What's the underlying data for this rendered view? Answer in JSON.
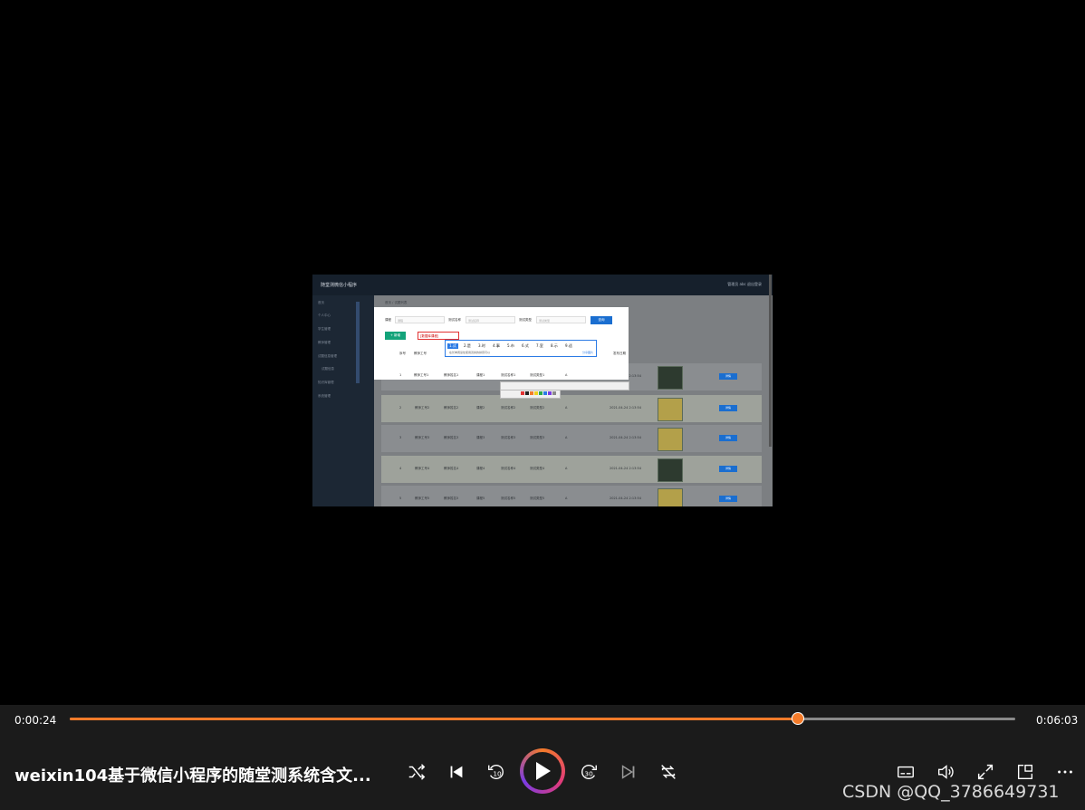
{
  "video": {
    "app_title": "随堂测微信小程序",
    "user_area": "管理员 abc    退出登录",
    "breadcrumb": "首页  /  试题列表",
    "sidebar": [
      "首页",
      "个人中心",
      "学生管理",
      "教师管理",
      "试题信息管理",
      "试题信息",
      "知识库管理",
      "系统管理"
    ],
    "rows": [
      {
        "idx": "1",
        "c1": "教师工号1",
        "c2": "教师姓名1",
        "c3": "课程1",
        "c4": "测试名称1",
        "c5": "测试类型1",
        "c6": "A",
        "c7": "2021-04-24 2:13:54",
        "btn": "详情"
      },
      {
        "idx": "2",
        "c1": "教师工号2",
        "c2": "教师姓名2",
        "c3": "课程2",
        "c4": "测试名称2",
        "c5": "测试类型2",
        "c6": "A",
        "c7": "2021-04-24 2:13:54",
        "btn": "详情"
      },
      {
        "idx": "3",
        "c1": "教师工号3",
        "c2": "教师姓名3",
        "c3": "课程3",
        "c4": "测试名称3",
        "c5": "测试类型3",
        "c6": "A",
        "c7": "2021-04-24 2:13:54",
        "btn": "详情"
      },
      {
        "idx": "4",
        "c1": "教师工号4",
        "c2": "教师姓名4",
        "c3": "课程4",
        "c4": "测试名称4",
        "c5": "测试类型4",
        "c6": "A",
        "c7": "2021-04-24 2:13:54",
        "btn": "详情"
      },
      {
        "idx": "5",
        "c1": "教师工号5",
        "c2": "教师姓名5",
        "c3": "课程5",
        "c4": "测试名称5",
        "c5": "测试类型5",
        "c6": "A",
        "c7": "2021-04-24 2:13:54",
        "btn": "详情"
      }
    ],
    "dialog": {
      "label_course": "课程",
      "label_test": "测试名称",
      "label_type": "测试类型",
      "ph_course": "课程",
      "ph_test": "测试名称",
      "ph_type": "测试类型",
      "search_label": "查询",
      "add_label": "+ 新增",
      "textbox_value": "[数据库课程]",
      "ime_candidates": [
        "1.试",
        "2.是",
        "3.时",
        "4.事",
        "5.市",
        "6.式",
        "7.室",
        "8.示",
        "9.适"
      ],
      "ime_hint": "在长单阅读处使用双拼的拼音可以",
      "ime_link": "分享图片",
      "headers": [
        "序号",
        "教师工号",
        "教师姓名",
        "课程",
        "测试名称",
        "测试类型",
        "答案",
        "发布日期"
      ],
      "row": [
        "1",
        "教师工号1",
        "教师姓名1",
        "课程1",
        "测试名称1",
        "测试类型1",
        "A",
        "2021-04-24 2:13:54"
      ]
    },
    "palette_colors": [
      "#e23232",
      "#222222",
      "#f47b2a",
      "#f0d020",
      "#2aa84a",
      "#2c7be5",
      "#7a3be2",
      "#8a8a8a"
    ]
  },
  "player": {
    "current_time": "0:00:24",
    "total_time": "0:06:03",
    "progress": 0.77,
    "title": "weixin104基于微信小程序的随堂测系统含文...",
    "watermark": "CSDN @QQ_3786649731",
    "accent": "#f47b2a",
    "icons": [
      "shuffle-icon",
      "previous-icon",
      "rewind-10-icon",
      "play-icon",
      "forward-30-icon",
      "next-icon",
      "repeat-off-icon",
      "captions-icon",
      "volume-icon",
      "fullscreen-icon",
      "mini-player-icon",
      "more-icon"
    ]
  }
}
